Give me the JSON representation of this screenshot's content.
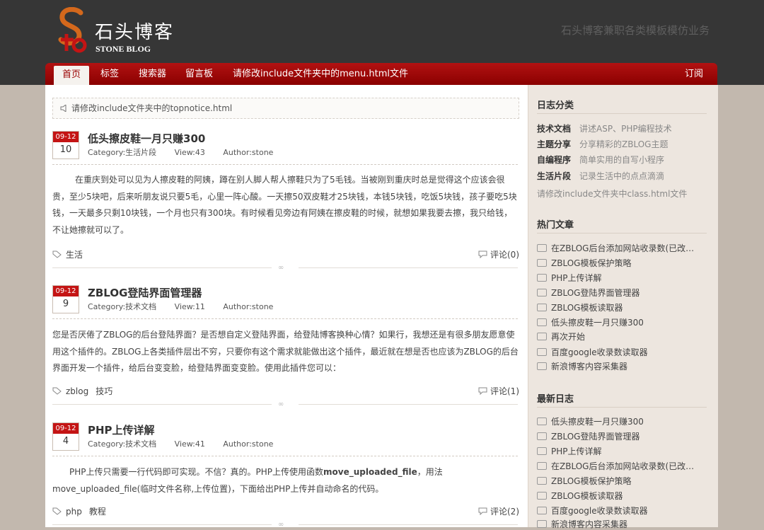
{
  "header": {
    "logo_cn": "石头博客",
    "logo_en": "STONE BLOG",
    "tagline": "石头博客兼职各类模板模仿业务"
  },
  "nav": {
    "items": [
      "首页",
      "标签",
      "搜索器",
      "留言板",
      "请修改include文件夹中的menu.html文件"
    ],
    "subscribe": "订阅"
  },
  "notice": "请修改include文件夹中的topnotice.html",
  "posts": [
    {
      "month": "09-12",
      "day": "10",
      "title": "低头擦皮鞋一月只赚300",
      "category": "Category:生活片段",
      "views": "View:43",
      "author": "Author:stone",
      "body": "在重庆到处可以见为人擦皮鞋的阿姨，蹲在别人脚人帮人擦鞋只为了5毛钱。当被刚到重庆时总是觉得这个应该会很贵，至少5块吧，后来听朋友说只要5毛，心里一阵心酸。一天擦50双皮鞋才25块钱，本钱5块钱，吃饭5块钱，孩子要吃5块钱，一天最多只剩10块钱，一个月也只有300块。有时候看见旁边有阿姨在擦皮鞋的时候，就想如果我要去擦，我只给钱，不让她擦就可以了。",
      "tags": [
        "生活"
      ],
      "comments": "评论(0)"
    },
    {
      "month": "09-12",
      "day": "9",
      "title": "ZBLOG登陆界面管理器",
      "category": "Category:技术文档",
      "views": "View:11",
      "author": "Author:stone",
      "body": "您是否厌倦了ZBLOG的后台登陆界面？是否想自定义登陆界面，给登陆博客换种心情？如果行，我想还是有很多朋友愿意使用这个插件的。ZBLOG上各类插件层出不穷，只要你有这个需求就能做出这个插件，最近就在想是否也应该为ZBLOG的后台界面开发一个插件，给后台变变脸，给登陆界面变变脸。使用此插件您可以：",
      "tags": [
        "zblog",
        "技巧"
      ],
      "comments": "评论(1)"
    },
    {
      "month": "09-12",
      "day": "4",
      "title": "PHP上传详解",
      "category": "Category:技术文档",
      "views": "View:41",
      "author": "Author:stone",
      "body_pre": "PHP上传只需要一行代码即可实现。不信？真的。PHP上传使用函数",
      "body_bold": "move_uploaded_file",
      "body_post": "，用法move_uploaded_file(临时文件名称,上传位置)，下面给出PHP上传并自动命名的代码。",
      "tags": [
        "php",
        "教程"
      ],
      "comments": "评论(2)"
    }
  ],
  "sidebar": {
    "categories_title": "日志分类",
    "categories": [
      {
        "name": "技术文档",
        "desc": "讲述ASP、PHP编程技术"
      },
      {
        "name": "主题分享",
        "desc": "分享精彩的ZBLOG主题"
      },
      {
        "name": "自编程序",
        "desc": "简单实用的自写小程序"
      },
      {
        "name": "生活片段",
        "desc": "记录生活中的点点滴滴"
      }
    ],
    "categories_note": "请修改include文件夹中class.html文件",
    "hot_title": "热门文章",
    "hot": [
      "在ZBLOG后台添加网站收录数(已改为...",
      "ZBLOG模板保护策略",
      "PHP上传详解",
      "ZBLOG登陆界面管理器",
      "ZBLOG模板读取器",
      "低头擦皮鞋一月只赚300",
      "再次开始",
      "百度google收录数读取器",
      "新浪博客内容采集器"
    ],
    "latest_title": "最新日志",
    "latest": [
      "低头擦皮鞋一月只赚300",
      "ZBLOG登陆界面管理器",
      "PHP上传详解",
      "在ZBLOG后台添加网站收录数(已改为...",
      "ZBLOG模板保护策略",
      "ZBLOG模板读取器",
      "百度google收录数读取器",
      "新浪博客内容采集器"
    ]
  },
  "colors": {
    "topbar": "#363636",
    "nav_red": "#a00000",
    "date_red": "#c41414",
    "page_bg": "#c2b8ae",
    "sidebar_bg": "#ede6df"
  }
}
